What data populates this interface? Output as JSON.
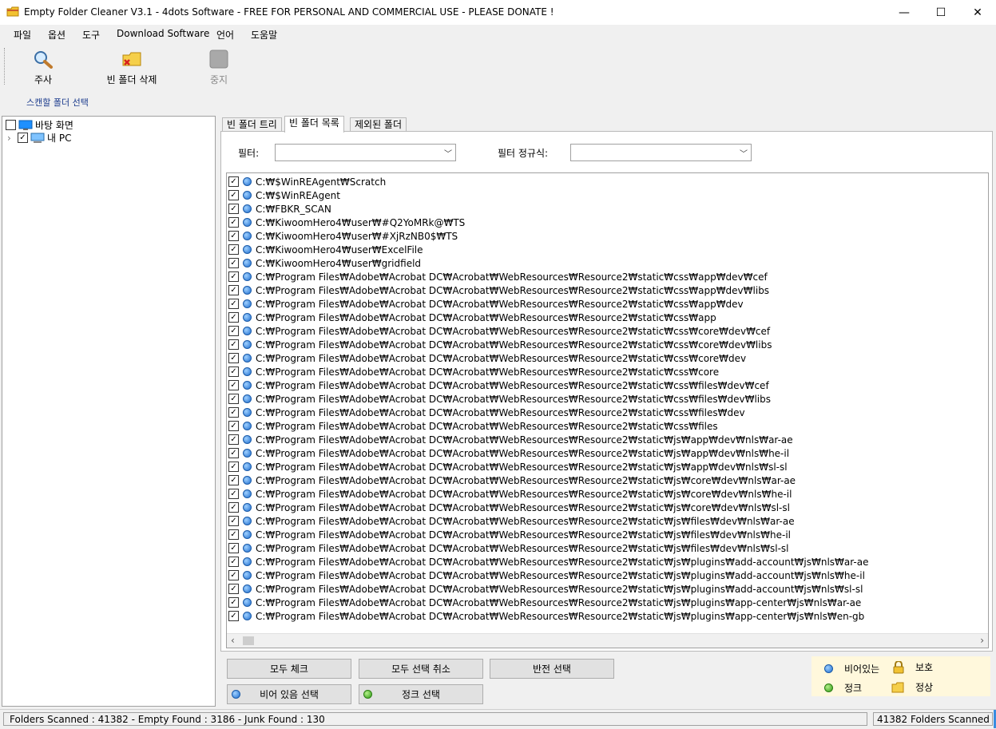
{
  "window": {
    "title": "Empty Folder Cleaner V3.1 - 4dots Software - FREE FOR PERSONAL AND COMMERCIAL USE - PLEASE DONATE !",
    "minimize": "—",
    "maximize": "☐",
    "close": "✕"
  },
  "menu": [
    "파일",
    "옵션",
    "도구",
    "Download Software",
    "언어",
    "도움말"
  ],
  "toolbar": {
    "scan_label": "주사",
    "delete_label": "빈 폴더 삭제",
    "stop_label": "중지"
  },
  "scan_folder_label": "스캔할 폴더 선택",
  "tree": [
    {
      "label": "바탕 화면",
      "checked": false
    },
    {
      "label": "내 PC",
      "checked": true,
      "expander": "›"
    }
  ],
  "tabs": [
    "빈 폴더 트리",
    "빈 폴더 목록",
    "제외된 폴더"
  ],
  "active_tab": 1,
  "filter": {
    "label": "필터:",
    "value": ""
  },
  "regex_filter": {
    "label": "필터 정규식:",
    "value": ""
  },
  "list": [
    "C:₩$WinREAgent₩Scratch",
    "C:₩$WinREAgent",
    "C:₩FBKR_SCAN",
    "C:₩KiwoomHero4₩user₩#Q2YoMRk@₩TS",
    "C:₩KiwoomHero4₩user₩#XjRzNB0$₩TS",
    "C:₩KiwoomHero4₩user₩ExcelFile",
    "C:₩KiwoomHero4₩user₩gridfield",
    "C:₩Program Files₩Adobe₩Acrobat DC₩Acrobat₩WebResources₩Resource2₩static₩css₩app₩dev₩cef",
    "C:₩Program Files₩Adobe₩Acrobat DC₩Acrobat₩WebResources₩Resource2₩static₩css₩app₩dev₩libs",
    "C:₩Program Files₩Adobe₩Acrobat DC₩Acrobat₩WebResources₩Resource2₩static₩css₩app₩dev",
    "C:₩Program Files₩Adobe₩Acrobat DC₩Acrobat₩WebResources₩Resource2₩static₩css₩app",
    "C:₩Program Files₩Adobe₩Acrobat DC₩Acrobat₩WebResources₩Resource2₩static₩css₩core₩dev₩cef",
    "C:₩Program Files₩Adobe₩Acrobat DC₩Acrobat₩WebResources₩Resource2₩static₩css₩core₩dev₩libs",
    "C:₩Program Files₩Adobe₩Acrobat DC₩Acrobat₩WebResources₩Resource2₩static₩css₩core₩dev",
    "C:₩Program Files₩Adobe₩Acrobat DC₩Acrobat₩WebResources₩Resource2₩static₩css₩core",
    "C:₩Program Files₩Adobe₩Acrobat DC₩Acrobat₩WebResources₩Resource2₩static₩css₩files₩dev₩cef",
    "C:₩Program Files₩Adobe₩Acrobat DC₩Acrobat₩WebResources₩Resource2₩static₩css₩files₩dev₩libs",
    "C:₩Program Files₩Adobe₩Acrobat DC₩Acrobat₩WebResources₩Resource2₩static₩css₩files₩dev",
    "C:₩Program Files₩Adobe₩Acrobat DC₩Acrobat₩WebResources₩Resource2₩static₩css₩files",
    "C:₩Program Files₩Adobe₩Acrobat DC₩Acrobat₩WebResources₩Resource2₩static₩js₩app₩dev₩nls₩ar-ae",
    "C:₩Program Files₩Adobe₩Acrobat DC₩Acrobat₩WebResources₩Resource2₩static₩js₩app₩dev₩nls₩he-il",
    "C:₩Program Files₩Adobe₩Acrobat DC₩Acrobat₩WebResources₩Resource2₩static₩js₩app₩dev₩nls₩sl-sl",
    "C:₩Program Files₩Adobe₩Acrobat DC₩Acrobat₩WebResources₩Resource2₩static₩js₩core₩dev₩nls₩ar-ae",
    "C:₩Program Files₩Adobe₩Acrobat DC₩Acrobat₩WebResources₩Resource2₩static₩js₩core₩dev₩nls₩he-il",
    "C:₩Program Files₩Adobe₩Acrobat DC₩Acrobat₩WebResources₩Resource2₩static₩js₩core₩dev₩nls₩sl-sl",
    "C:₩Program Files₩Adobe₩Acrobat DC₩Acrobat₩WebResources₩Resource2₩static₩js₩files₩dev₩nls₩ar-ae",
    "C:₩Program Files₩Adobe₩Acrobat DC₩Acrobat₩WebResources₩Resource2₩static₩js₩files₩dev₩nls₩he-il",
    "C:₩Program Files₩Adobe₩Acrobat DC₩Acrobat₩WebResources₩Resource2₩static₩js₩files₩dev₩nls₩sl-sl",
    "C:₩Program Files₩Adobe₩Acrobat DC₩Acrobat₩WebResources₩Resource2₩static₩js₩plugins₩add-account₩js₩nls₩ar-ae",
    "C:₩Program Files₩Adobe₩Acrobat DC₩Acrobat₩WebResources₩Resource2₩static₩js₩plugins₩add-account₩js₩nls₩he-il",
    "C:₩Program Files₩Adobe₩Acrobat DC₩Acrobat₩WebResources₩Resource2₩static₩js₩plugins₩add-account₩js₩nls₩sl-sl",
    "C:₩Program Files₩Adobe₩Acrobat DC₩Acrobat₩WebResources₩Resource2₩static₩js₩plugins₩app-center₩js₩nls₩ar-ae",
    "C:₩Program Files₩Adobe₩Acrobat DC₩Acrobat₩WebResources₩Resource2₩static₩js₩plugins₩app-center₩js₩nls₩en-gb"
  ],
  "buttons": {
    "check_all": "모두 체크",
    "uncheck_all": "모두 선택 취소",
    "invert": "반전 선택",
    "select_empty": "비어 있음 선택",
    "select_junk": "정크 선택"
  },
  "legend": {
    "empty": "비어있는",
    "protected": "보호",
    "junk": "정크",
    "normal": "정상"
  },
  "status": {
    "left": "Folders Scanned : 41382 - Empty Found : 3186 - Junk Found : 130",
    "right": "41382 Folders Scanned"
  },
  "colors": {
    "empty_dot": "#1f6fd0",
    "junk_dot": "#2f9a16",
    "legend_bg": "#fff8dc",
    "scan_label": "#1a3a8c"
  },
  "icons": {
    "scan": "magnifier-icon",
    "delete": "folder-delete-icon",
    "stop": "stop-icon",
    "protected": "lock-icon",
    "normal": "folder-icon"
  }
}
